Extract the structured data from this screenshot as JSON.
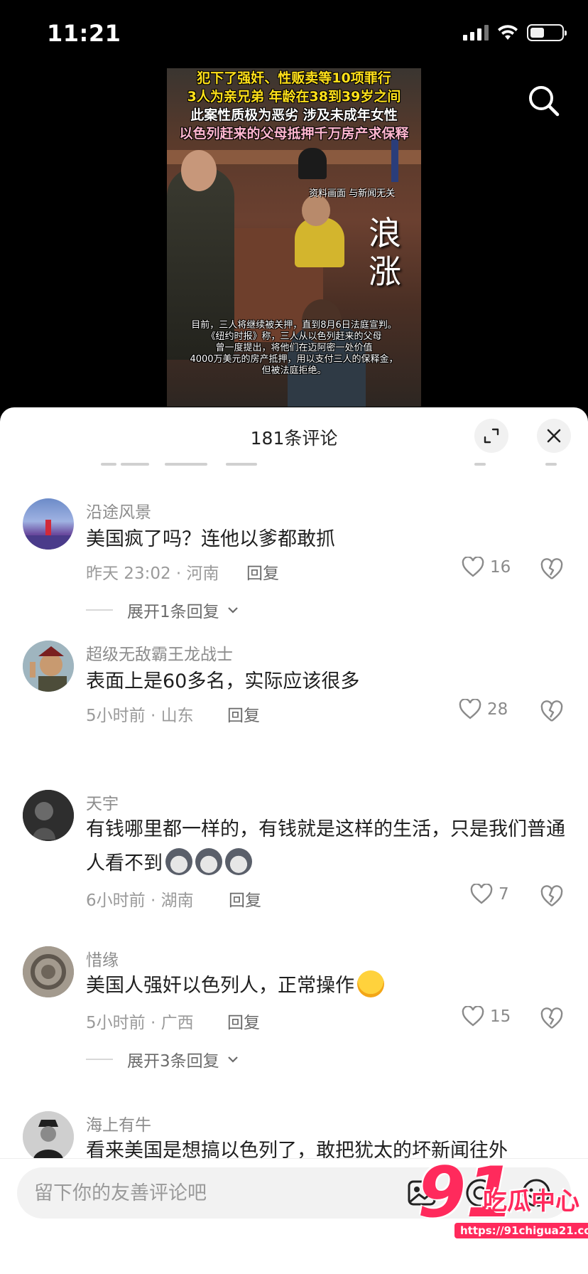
{
  "status_bar": {
    "time": "11:21"
  },
  "video": {
    "overlay_lines": [
      "犯下了强奸、性贩卖等10项罪行",
      "3人为亲兄弟 年龄在38到39岁之间",
      "此案性质极为恶劣 涉及未成年女性",
      "以色列赶来的父母抵押千万房产求保释"
    ],
    "disclaimer": "资料画面 与新闻无关",
    "logo_text": "浪涨",
    "bottom_lines": [
      "目前，三人将继续被关押，直到8月6日法庭宣判。",
      "《纽约时报》称，三人从以色列赶来的父母",
      "曾一度提出，将他们在迈阿密一处价值",
      "4000万美元的房产抵押，用以支付三人的保释金，",
      "但被法庭拒绝。"
    ],
    "search_icon": "search-icon"
  },
  "comments_header": {
    "title": "181条评论"
  },
  "comments": [
    {
      "username": "沿途风景",
      "text": "美国疯了吗？连他以爹都敢抓",
      "meta": "昨天 23:02 · 河南",
      "reply_label": "回复",
      "likes": "16",
      "expand_label": "展开1条回复"
    },
    {
      "username": "超级无敌霸王龙战士",
      "text": "表面上是60多名，实际应该很多",
      "meta": "5小时前 · 山东",
      "reply_label": "回复",
      "likes": "28"
    },
    {
      "username": "天宇",
      "text": "有钱哪里都一样的，有钱就是这样的生活，只是我们普通人看不到",
      "meta": "6小时前 · 湖南",
      "reply_label": "回复",
      "likes": "7"
    },
    {
      "username": "惜缘",
      "text": "美国人强奸以色列人，正常操作",
      "meta": "5小时前 · 广西",
      "reply_label": "回复",
      "likes": "15",
      "expand_label": "展开3条回复"
    },
    {
      "username": "海上有牛",
      "text": "看来美国是想搞以色列了，敢把犹太的坏新闻往外"
    }
  ],
  "input_bar": {
    "placeholder": "留下你的友善评论吧"
  },
  "watermark": {
    "number": "91",
    "name": "吃瓜中心",
    "url": "https://91chigua21.com"
  },
  "colors": {
    "accent": "#ff2a5c",
    "sheet_bg": "#ffffff",
    "caption_yellow": "#ffe01a"
  }
}
